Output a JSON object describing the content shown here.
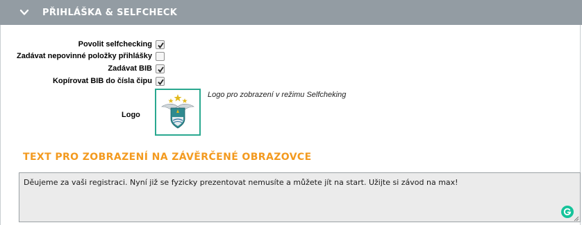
{
  "section": {
    "title": "PŘIHLÁŠKA & SELFCHECK",
    "toggle_icon": "chevron-down-icon"
  },
  "options": [
    {
      "label": "Povolit selfchecking",
      "checked": true
    },
    {
      "label": "Zadávat nepovinné položky přihlášky",
      "checked": false
    },
    {
      "label": "Zadávat BIB",
      "checked": true
    },
    {
      "label": "Kopírovat BIB do čísla čipu",
      "checked": true
    }
  ],
  "logo": {
    "label": "Logo",
    "hint": "Logo pro zobrazení v režimu Selfcheking"
  },
  "final_screen": {
    "title": "TEXT PRO ZOBRAZENÍ NA ZÁVĚRČENÉ OBRAZOVCE",
    "text": "Děujeme za vaši registraci. Nyní již se fyzicky prezentovat nemusíte a můžete jít na start. Užijte si závod na max!"
  },
  "colors": {
    "header_bg": "#939ca3",
    "accent_orange": "#f39a1f",
    "logo_border": "#29a88f",
    "grammarly": "#15c39a"
  }
}
